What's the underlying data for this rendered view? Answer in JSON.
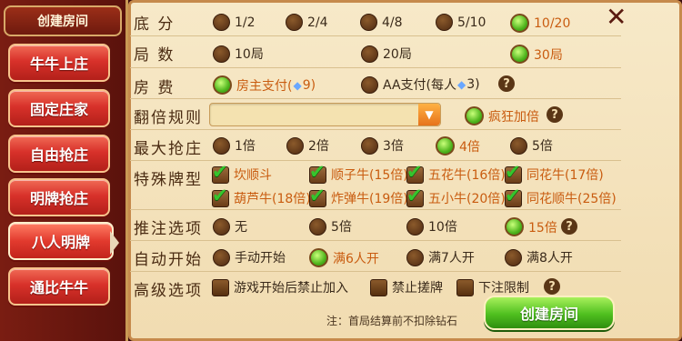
{
  "sidebar": {
    "header": "创建房间",
    "modes": [
      "牛牛上庄",
      "固定庄家",
      "自由抢庄",
      "明牌抢庄",
      "八人明牌",
      "通比牛牛"
    ],
    "active_index": 4
  },
  "labels": {
    "base_score": "底 分",
    "rounds": "局 数",
    "room_fee": "房 费",
    "double_rule": "翻倍规则",
    "max_grab": "最大抢庄",
    "special_type": "特殊牌型",
    "bet_options": "推注选项",
    "auto_start": "自动开始",
    "advanced": "高级选项"
  },
  "base_score": {
    "options": [
      "1/2",
      "2/4",
      "4/8",
      "5/10",
      "10/20"
    ],
    "selected": "10/20"
  },
  "rounds": {
    "options": [
      "10局",
      "20局",
      "30局"
    ],
    "selected": "30局"
  },
  "room_fee": {
    "owner_prefix": "房主支付(",
    "owner_suffix": " 9)",
    "aa_prefix": "AA支付(每人",
    "aa_suffix": " 3)",
    "diamond_glyph": "◆",
    "selected": "owner"
  },
  "double_rule": {
    "dropdown_value": "",
    "option": "疯狂加倍",
    "selected": true
  },
  "max_grab": {
    "options": [
      "1倍",
      "2倍",
      "3倍",
      "4倍",
      "5倍"
    ],
    "selected": "4倍"
  },
  "special_types": [
    "坎顺斗",
    "顺子牛(15倍)",
    "五花牛(16倍)",
    "同花牛(17倍)",
    "葫芦牛(18倍)",
    "炸弹牛(19倍)",
    "五小牛(20倍)",
    "同花顺牛(25倍)"
  ],
  "bet_options": {
    "options": [
      "无",
      "5倍",
      "10倍",
      "15倍"
    ],
    "selected": "15倍"
  },
  "auto_start": {
    "options": [
      "手动开始",
      "满6人开",
      "满7人开",
      "满8人开"
    ],
    "selected": "满6人开"
  },
  "advanced": {
    "options": [
      "游戏开始后禁止加入",
      "禁止搓牌",
      "下注限制"
    ]
  },
  "help_glyph": "?",
  "close_glyph": "✕",
  "dropdown_glyph": "▼",
  "create_button": "创建房间",
  "note": "注：首局结算前不扣除钻石",
  "colors": {
    "accent_green": "#4fb51d",
    "selected_text": "#c95c10",
    "brand_red": "#d8312a"
  }
}
